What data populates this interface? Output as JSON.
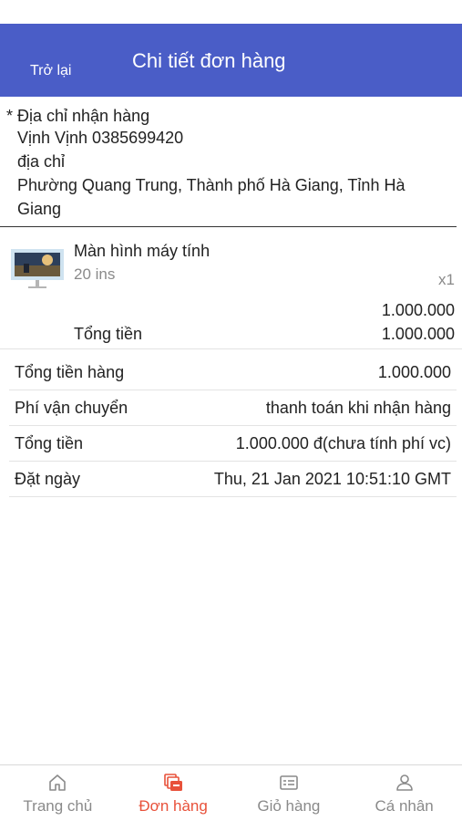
{
  "header": {
    "back_label": "Trở lại",
    "title": "Chi tiết đơn hàng"
  },
  "address": {
    "heading": "* Địa chỉ nhận hàng",
    "name_phone": "Vịnh Vịnh 0385699420",
    "label": "địa chỉ",
    "line1": "Phường Quang Trung, Thành phố Hà Giang, Tỉnh Hà",
    "line2": "Giang"
  },
  "product": {
    "name": "Màn hình máy tính",
    "variant": "20 ins",
    "quantity": "x1",
    "price": "1.000.000",
    "total_label": "Tổng tiền",
    "total_value": "1.000.000",
    "thumbnail_icon": "monitor-image"
  },
  "summary": [
    {
      "label": "Tổng tiền hàng",
      "value": "1.000.000"
    },
    {
      "label": "Phí vận chuyển",
      "value": "thanh toán khi nhận hàng"
    },
    {
      "label": "Tổng tiền",
      "value": "1.000.000 đ(chưa tính phí vc)"
    },
    {
      "label": "Đặt ngày",
      "value": "Thu, 21 Jan 2021 10:51:10 GMT"
    }
  ],
  "tabs": [
    {
      "label": "Trang chủ",
      "icon": "home-icon"
    },
    {
      "label": "Đơn hàng",
      "icon": "orders-icon",
      "active": true
    },
    {
      "label": "Giỏ hàng",
      "icon": "cart-icon"
    },
    {
      "label": "Cá nhân",
      "icon": "user-icon"
    }
  ],
  "colors": {
    "header_bg": "#4a5dc7",
    "active_tab": "#e8513a",
    "inactive_tab": "#8a8a8a"
  }
}
